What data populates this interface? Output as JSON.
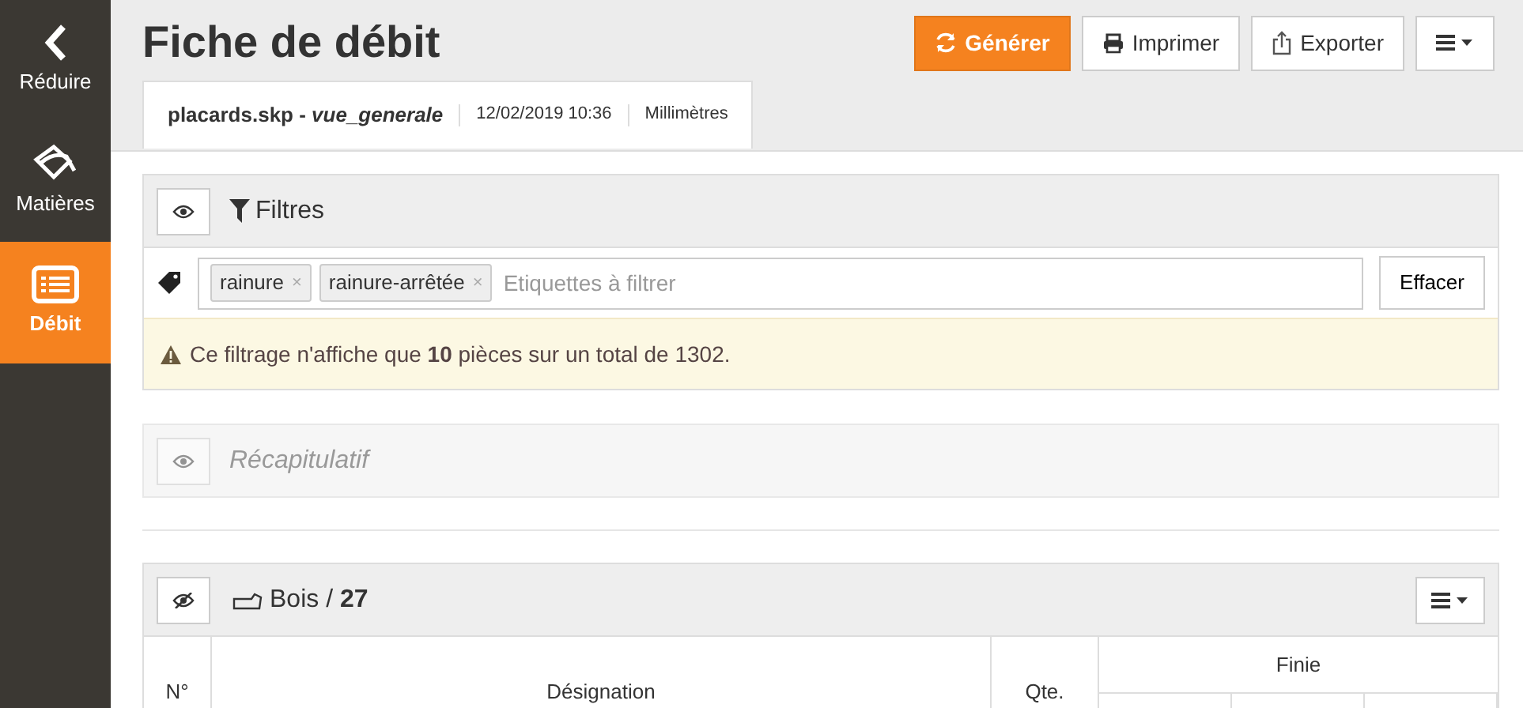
{
  "sidebar": {
    "items": [
      {
        "kind": "collapse",
        "label": "Réduire",
        "selected": false
      },
      {
        "kind": "materials",
        "label": "Matières",
        "selected": false
      },
      {
        "kind": "cutlist",
        "label": "Débit",
        "selected": true
      }
    ]
  },
  "header": {
    "title": "Fiche de débit",
    "buttons": [
      {
        "kind": "generate",
        "label": "Générer",
        "primary": true
      },
      {
        "kind": "print",
        "label": "Imprimer",
        "primary": false
      },
      {
        "kind": "export",
        "label": "Exporter",
        "primary": false
      },
      {
        "kind": "menu",
        "primary": false
      }
    ]
  },
  "tab": {
    "file": "placards.skp - ",
    "view": "vue_generale",
    "date": "12/02/2019 10:36",
    "unit": "Millimètres"
  },
  "filters": {
    "title": "Filtres",
    "tags": [
      {
        "label": "rainure",
        "remove": "×"
      },
      {
        "label": "rainure-arrêtée",
        "remove": "×"
      }
    ],
    "placeholder": "Etiquettes à filtrer",
    "clear_button": "Effacer",
    "alert": "Ce filtrage n'affiche que **10** pièces sur un total de 1302."
  },
  "summary": {
    "title": "Récapitulatif",
    "visible": false
  },
  "material_section": {
    "title": "Bois / **27**",
    "visible": true,
    "columns": [
      "N°",
      "Désignation",
      "Qte.",
      "Finie"
    ]
  }
}
